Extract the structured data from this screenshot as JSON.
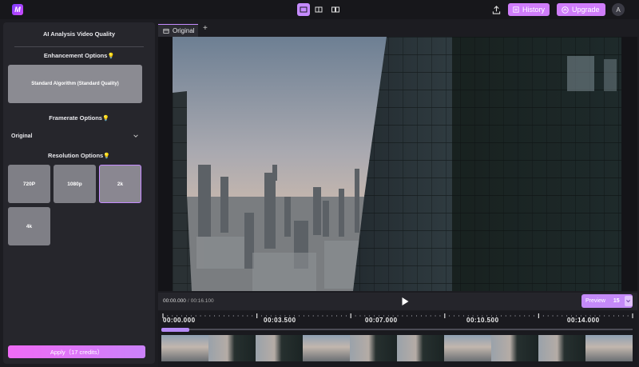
{
  "header": {
    "logo_text": "M",
    "history_label": "History",
    "upgrade_label": "Upgrade",
    "avatar_initial": "A"
  },
  "panel": {
    "title": "AI Analysis Video Quality",
    "enhancement_title": "Enhancement Options",
    "algorithm_label": "Standard Algorithm (Standard Quality)",
    "framerate_title": "Framerate Options",
    "framerate_value": "Original",
    "resolution_title": "Resolution Options",
    "resolutions": [
      "720P",
      "1080p",
      "2k",
      "4k"
    ],
    "selected_resolution": "2k",
    "apply_label": "Apply（17 credits）"
  },
  "editor": {
    "tab_label": "Original",
    "add_tab": "+",
    "current_time": "00:00.000",
    "separator": "/",
    "total_time": "00:16.100",
    "preview_label": "Preview",
    "preview_fps": "15"
  },
  "timeline": {
    "labels": [
      "00:00.000",
      "00:03.500",
      "00:07.000",
      "00:10.500",
      "00:14.000"
    ],
    "playhead_fraction": 0.06
  },
  "colors": {
    "accent": "#c58bff",
    "panel_bg": "#26262c",
    "app_bg": "#1c1c21"
  }
}
